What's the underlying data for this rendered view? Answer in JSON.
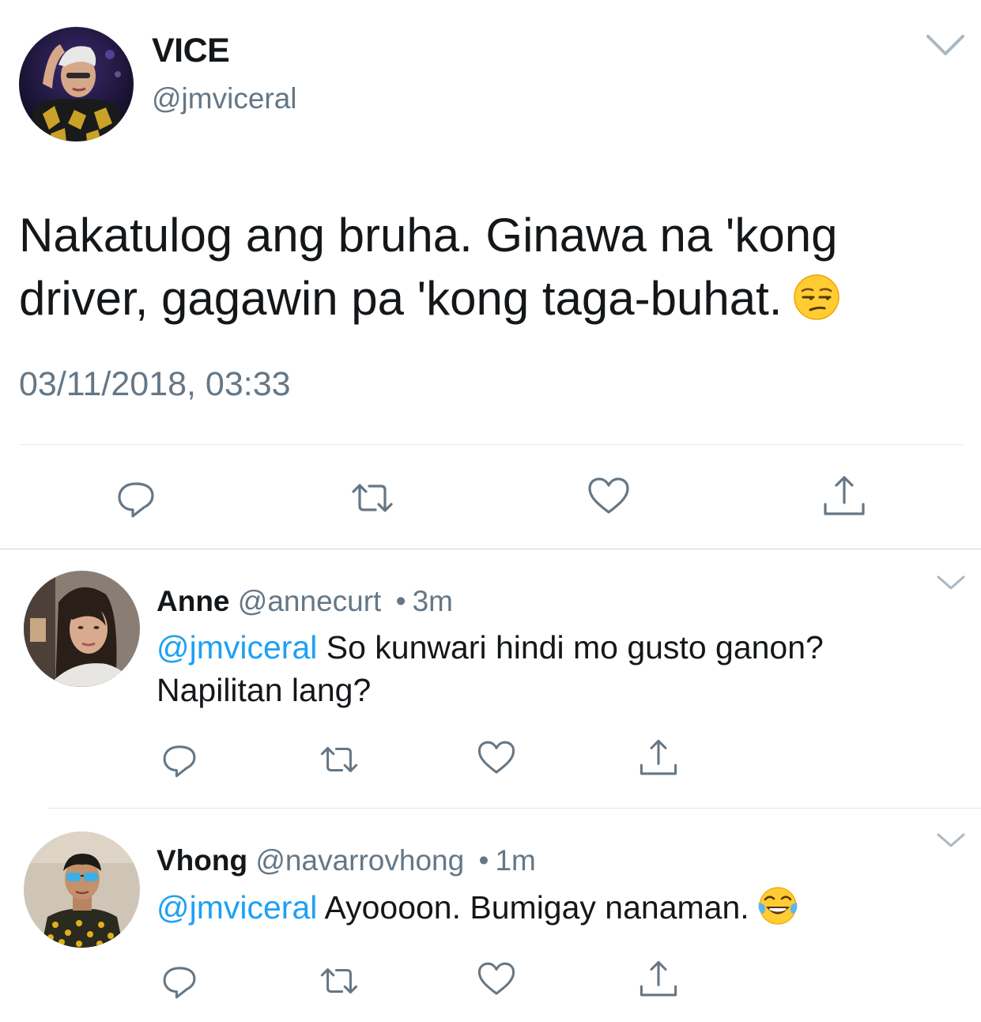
{
  "main_tweet": {
    "name": "VICE",
    "handle": "@jmviceral",
    "text": "Nakatulog ang bruha. Ginawa na 'kong driver, gagawin pa 'kong taga-buhat.",
    "emoji": "unamused-face-emoji",
    "timestamp": "03/11/2018, 03:33"
  },
  "replies": [
    {
      "name": "Anne",
      "handle": "@annecurt",
      "dot": "•",
      "time": "3m",
      "mention": "@jmviceral",
      "text": " So kunwari hindi mo gusto ganon? Napilitan lang?"
    },
    {
      "name": "Vhong",
      "handle": "@navarrovhong",
      "dot": "•",
      "time": "1m",
      "mention": "@jmviceral",
      "text": " Ayoooon. Bumigay nanaman.",
      "emoji": "tears-of-joy-emoji"
    }
  ],
  "colors": {
    "text": "#14171a",
    "secondary": "#657786",
    "mention": "#1da1f2",
    "divider": "#e1e8ed"
  },
  "icons": [
    "reply-icon",
    "retweet-icon",
    "like-icon",
    "share-icon",
    "chevron-down-icon"
  ]
}
